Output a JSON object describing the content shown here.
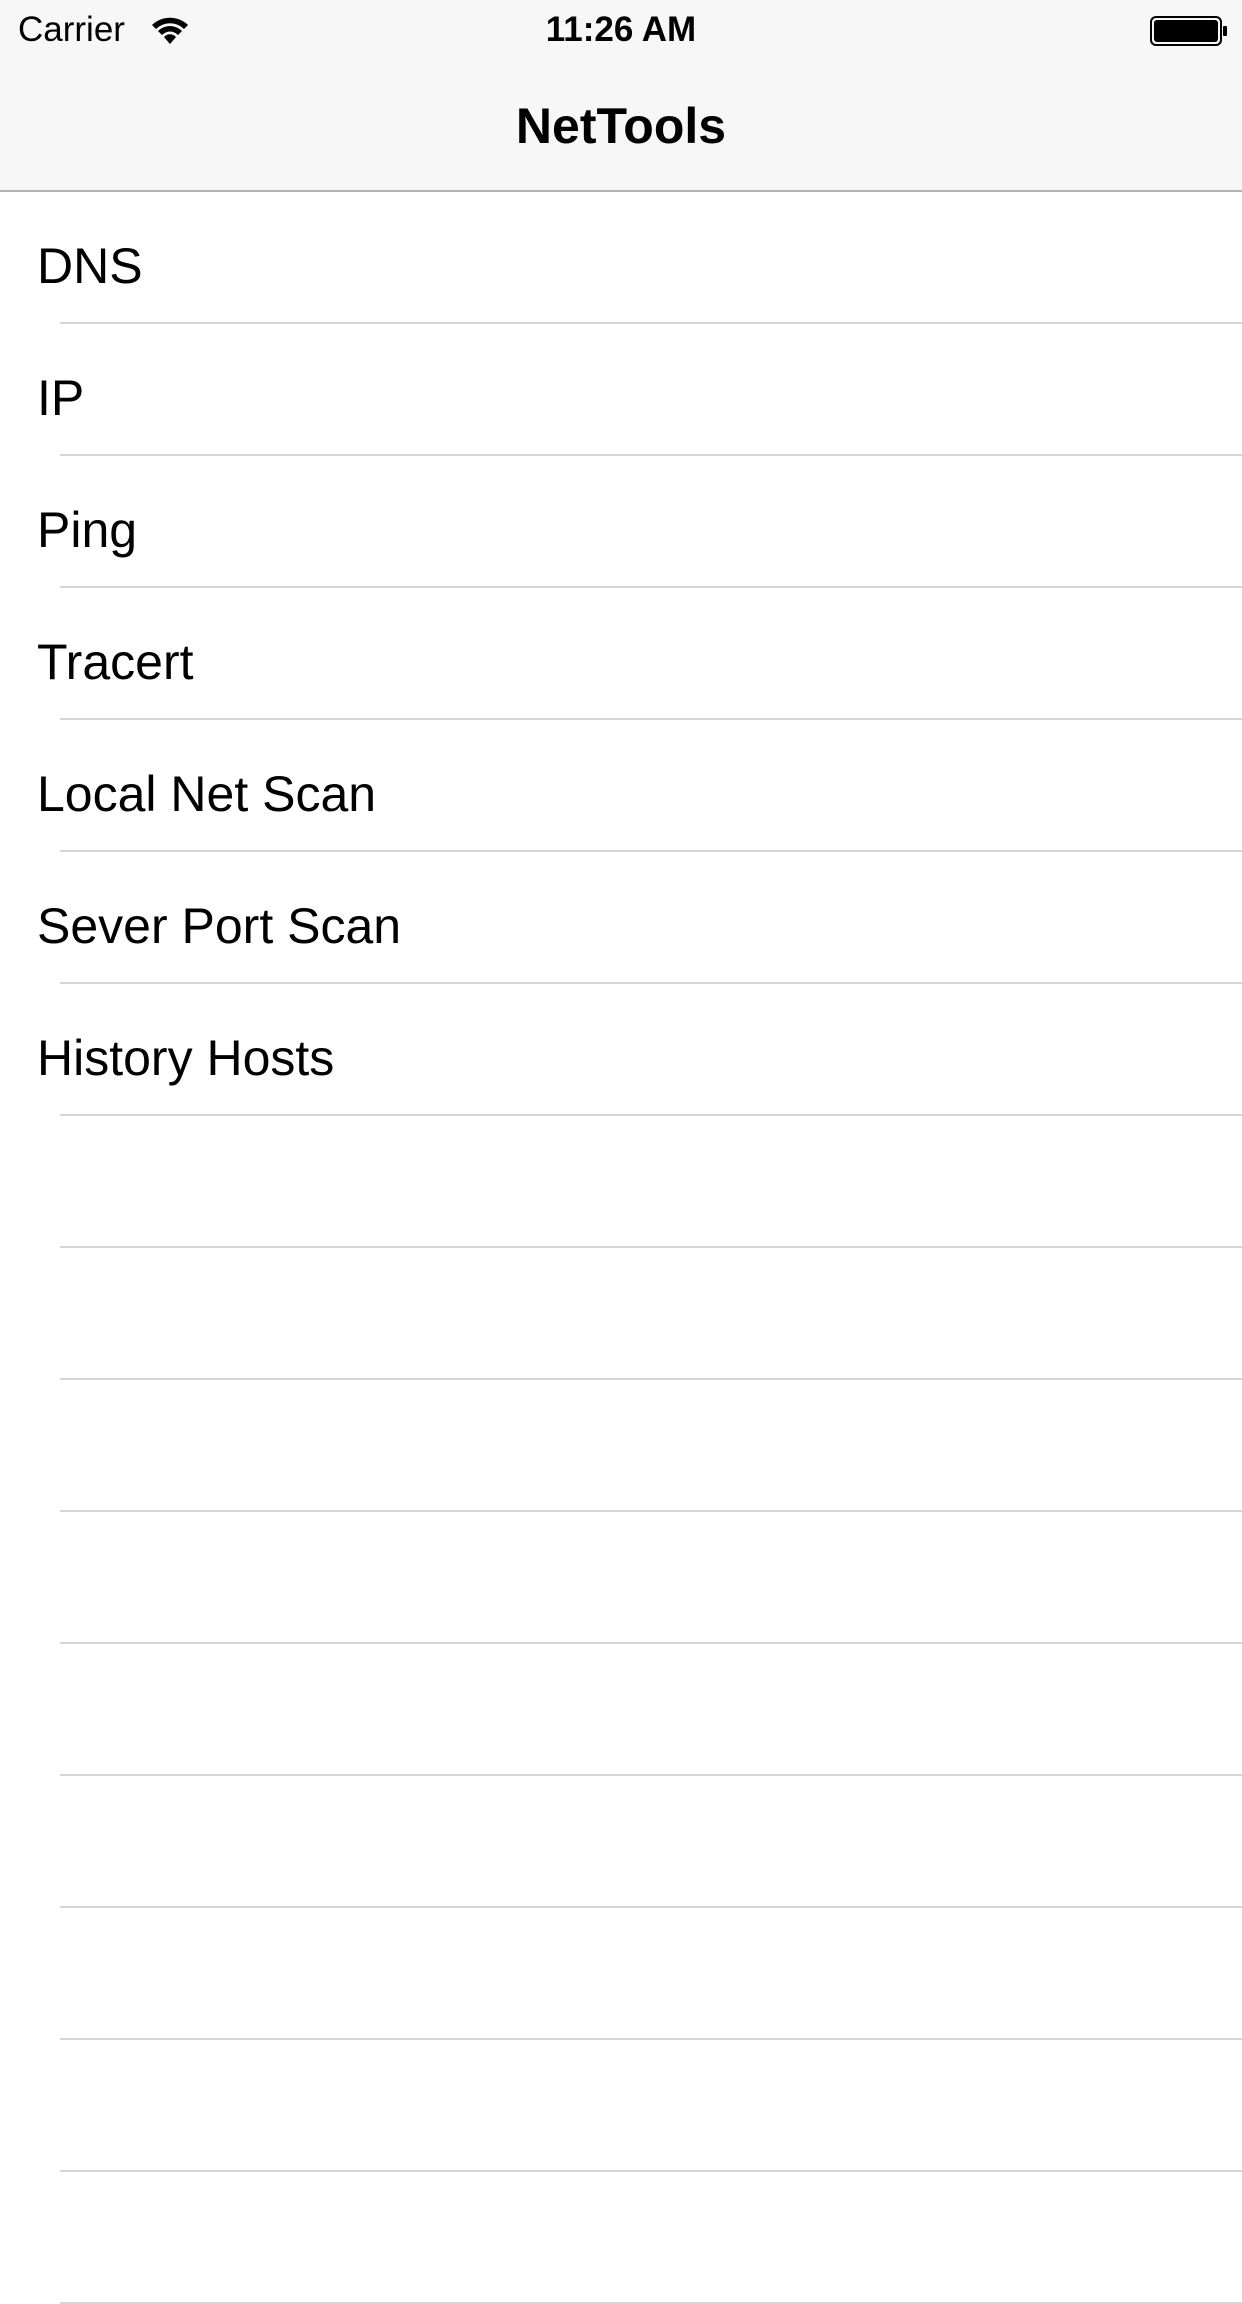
{
  "status_bar": {
    "carrier": "Carrier",
    "time": "11:26 AM",
    "wifi_icon": "wifi-icon",
    "battery_icon": "battery-icon"
  },
  "nav": {
    "title": "NetTools"
  },
  "menu": {
    "items": [
      {
        "label": "DNS"
      },
      {
        "label": "IP"
      },
      {
        "label": "Ping"
      },
      {
        "label": "Tracert"
      },
      {
        "label": "Local Net Scan"
      },
      {
        "label": "Sever Port Scan"
      },
      {
        "label": "History Hosts"
      }
    ]
  },
  "colors": {
    "nav_background": "#f7f7f7",
    "separator": "#d6d6d9",
    "text": "#000000"
  }
}
